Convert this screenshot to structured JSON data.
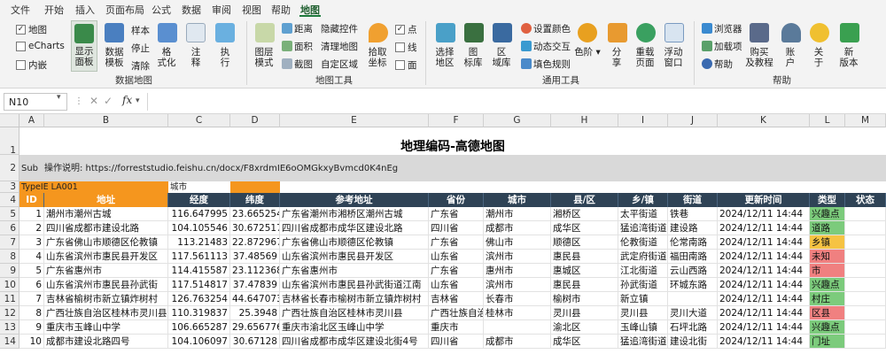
{
  "menu": {
    "tabs": [
      "文件",
      "开始",
      "插入",
      "页面布局",
      "公式",
      "数据",
      "审阅",
      "视图",
      "帮助",
      "地图"
    ],
    "active_tab": "地图"
  },
  "ribbon": {
    "checks": [
      {
        "label": "地图",
        "checked": true
      },
      {
        "label": "eCharts",
        "checked": false
      },
      {
        "label": "内嵌",
        "checked": false
      }
    ],
    "data_map": {
      "show_panel": "显示\n面板",
      "data_template": "数据\n模板",
      "sample": "样本",
      "stop": "停止",
      "clear": "清除",
      "format": "格\n式化",
      "annotate": "注\n释",
      "execute": "执\n行",
      "group_label": "数据地图"
    },
    "map_tools": {
      "layer_mode": "图层\n模式",
      "distance": "距离",
      "area": "面积",
      "screenshot": "截图",
      "hide_control": "隐藏控件",
      "clear_map": "清理地图",
      "custom_region": "自定区域",
      "pick_coords": "拾取\n坐标",
      "point": "点",
      "line": "线",
      "polygon": "面",
      "point_checked": true,
      "line_checked": false,
      "polygon_checked": false,
      "group_label": "地图工具"
    },
    "common_tools": {
      "select_region": "选择\n地区",
      "icon_lib": "图\n标库",
      "region_lib": "区\n域库",
      "set_color": "设置颜色",
      "dynamic_interact": "动态交互",
      "fill_rule": "填色规则",
      "palette": "色阶",
      "share": "分\n享",
      "reload_page": "重载\n页面",
      "float_window": "浮动\n窗口",
      "group_label": "通用工具"
    },
    "help": {
      "browser": "浏览器",
      "addon": "加载项",
      "help": "帮助",
      "buy": "购买\n及教程",
      "account": "账\n户",
      "about": "关\n于",
      "new_version": "新\n版本",
      "group_label": "帮助"
    }
  },
  "formula_bar": {
    "name_box": "N10",
    "formula": ""
  },
  "sheet": {
    "columns": [
      "A",
      "B",
      "C",
      "D",
      "E",
      "F",
      "G",
      "H",
      "I",
      "J",
      "K",
      "L",
      "M"
    ],
    "title": "地理编码-高德地图",
    "row2": {
      "a": "Sub",
      "b": "操作说明:   https://forreststudio.feishu.cn/docx/F8xrdmIE6oOMGkxyBvmcd0K4nEg"
    },
    "row3": {
      "a": "TypeIE LA001",
      "c": "城市"
    },
    "headers": [
      "ID",
      "地址",
      "经度",
      "纬度",
      "参考地址",
      "省份",
      "城市",
      "县/区",
      "乡/镇",
      "街道",
      "更新时间",
      "类型",
      "状态"
    ],
    "rows": [
      {
        "id": "1",
        "addr": "潮州市潮州古城",
        "lng": "116.647995",
        "lat": "23.665254",
        "ref": "广东省潮州市湘桥区潮州古城",
        "prov": "广东省",
        "city": "潮州市",
        "dist": "湘桥区",
        "town": "太平街道",
        "street": "铁巷",
        "time": "2024/12/11 14:44",
        "type": "兴趣点",
        "type_color": "#7ccb7c"
      },
      {
        "id": "2",
        "addr": "四川省成都市建设北路",
        "lng": "104.105546",
        "lat": "30.672517",
        "ref": "四川省成都市成华区建设北路",
        "prov": "四川省",
        "city": "成都市",
        "dist": "成华区",
        "town": "猛追湾街道",
        "street": "建设路",
        "time": "2024/12/11 14:44",
        "type": "道路",
        "type_color": "#7ccb7c"
      },
      {
        "id": "3",
        "addr": "广东省佛山市顺德区伦教镇",
        "lng": "113.21483",
        "lat": "22.872967",
        "ref": "广东省佛山市顺德区伦教镇",
        "prov": "广东省",
        "city": "佛山市",
        "dist": "顺德区",
        "town": "伦教街道",
        "street": "伦常南路",
        "time": "2024/12/11 14:44",
        "type": "乡镇",
        "type_color": "#f6c343"
      },
      {
        "id": "4",
        "addr": "山东省滨州市惠民县开发区",
        "lng": "117.561113",
        "lat": "37.48569",
        "ref": "山东省滨州市惠民县开发区",
        "prov": "山东省",
        "city": "滨州市",
        "dist": "惠民县",
        "town": "武定府街道",
        "street": "福田南路",
        "time": "2024/12/11 14:44",
        "type": "未知",
        "type_color": "#f08080"
      },
      {
        "id": "5",
        "addr": "广东省惠州市",
        "lng": "114.415587",
        "lat": "23.112368",
        "ref": "广东省惠州市",
        "prov": "广东省",
        "city": "惠州市",
        "dist": "惠城区",
        "town": "江北街道",
        "street": "云山西路",
        "time": "2024/12/11 14:44",
        "type": "市",
        "type_color": "#f08080"
      },
      {
        "id": "6",
        "addr": "山东省滨州市惠民县孙武街",
        "lng": "117.514817",
        "lat": "37.47839",
        "ref": "山东省滨州市惠民县孙武街道江南",
        "prov": "山东省",
        "city": "滨州市",
        "dist": "惠民县",
        "town": "孙武街道",
        "street": "环城东路",
        "time": "2024/12/11 14:44",
        "type": "兴趣点",
        "type_color": "#7ccb7c"
      },
      {
        "id": "7",
        "addr": "吉林省榆树市新立镇炸树村",
        "lng": "126.763254",
        "lat": "44.647073",
        "ref": "吉林省长春市榆树市新立镇炸树村",
        "prov": "吉林省",
        "city": "长春市",
        "dist": "榆树市",
        "town": "新立镇",
        "street": "",
        "time": "2024/12/11 14:44",
        "type": "村庄",
        "type_color": "#7ccb7c"
      },
      {
        "id": "8",
        "addr": "广西壮族自治区桂林市灵川县",
        "lng": "110.319837",
        "lat": "25.3948",
        "ref": "广西壮族自治区桂林市灵川县",
        "prov": "广西壮族自治",
        "city": "桂林市",
        "dist": "灵川县",
        "town": "灵川县",
        "street": "灵川大道",
        "time": "2024/12/11 14:44",
        "type": "区县",
        "type_color": "#f08080"
      },
      {
        "id": "9",
        "addr": "重庆市玉峰山中学",
        "lng": "106.665287",
        "lat": "29.656776",
        "ref": "重庆市渝北区玉峰山中学",
        "prov": "重庆市",
        "city": "",
        "dist": "渝北区",
        "town": "玉峰山镇",
        "street": "石坪北路",
        "time": "2024/12/11 14:44",
        "type": "兴趣点",
        "type_color": "#7ccb7c"
      },
      {
        "id": "10",
        "addr": "成都市建设北路四号",
        "lng": "104.106097",
        "lat": "30.67128",
        "ref": "四川省成都市成华区建设北街4号",
        "prov": "四川省",
        "city": "成都市",
        "dist": "成华区",
        "town": "猛追湾街道",
        "street": "建设北街",
        "time": "2024/12/11 14:44",
        "type": "门址",
        "type_color": "#7ccb7c"
      }
    ]
  },
  "colors": {
    "header_dark": "#2f4356",
    "header_orange": "#f5961e",
    "row3_orange": "#f5961e",
    "sub_gray": "#d9d9d9"
  }
}
